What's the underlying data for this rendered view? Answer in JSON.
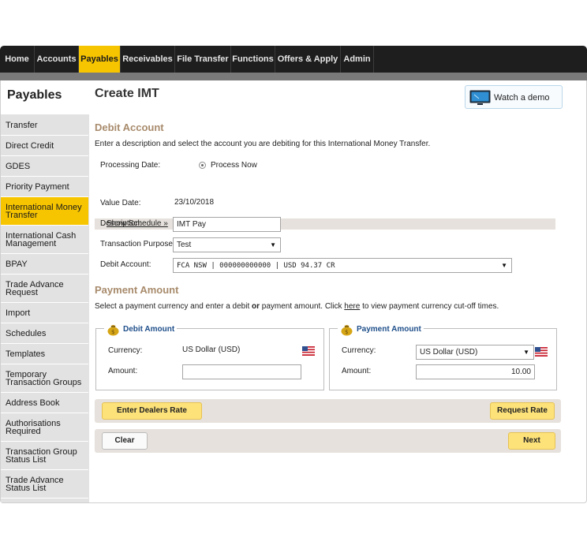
{
  "nav": {
    "tabs": [
      {
        "label": "Home"
      },
      {
        "label": "Accounts"
      },
      {
        "label": "Payables"
      },
      {
        "label": "Receivables"
      },
      {
        "label": "File Transfer"
      },
      {
        "label": "Functions"
      },
      {
        "label": "Offers & Apply"
      },
      {
        "label": "Admin"
      }
    ],
    "active_tab": "Payables"
  },
  "sidebar": {
    "title": "Payables",
    "items": [
      {
        "label": "Transfer"
      },
      {
        "label": "Direct Credit"
      },
      {
        "label": "GDES"
      },
      {
        "label": "Priority Payment"
      },
      {
        "label": "International Money Transfer"
      },
      {
        "label": "International Cash Management"
      },
      {
        "label": "BPAY"
      },
      {
        "label": "Trade Advance Request"
      },
      {
        "label": "Import"
      },
      {
        "label": "Schedules"
      },
      {
        "label": "Templates"
      },
      {
        "label": "Temporary Transaction Groups"
      },
      {
        "label": "Address Book"
      },
      {
        "label": "Authorisations Required"
      },
      {
        "label": "Transaction Group Status List"
      },
      {
        "label": "Trade Advance Status List"
      }
    ],
    "active_item": "International Money Transfer"
  },
  "main": {
    "title": "Create IMT",
    "demo_button": {
      "label": "Watch a demo",
      "icon": "monitor-icon"
    },
    "debit_account": {
      "heading": "Debit Account",
      "intro": "Enter a description and select the account you are debiting for this International Money Transfer.",
      "processing_date_label": "Processing Date:",
      "processing_date_option": "Process Now",
      "show_schedule": "Show Schedule »",
      "value_date_label": "Value Date:",
      "value_date": "23/10/2018",
      "description_label": "Description:",
      "description_value": "IMT Pay",
      "purpose_label": "Transaction Purpose:",
      "purpose_value": "Test",
      "account_label": "Debit Account:",
      "account_value": "FCA NSW | 000000000000 | USD 94.37 CR"
    },
    "payment_amount": {
      "heading": "Payment Amount",
      "intro_before": "Select a payment currency and enter a debit ",
      "intro_or": "or",
      "intro_middle": " payment amount. Click ",
      "intro_link": "here",
      "intro_after": " to view payment currency cut-off times.",
      "debit_box": {
        "title": "Debit Amount",
        "currency_label": "Currency:",
        "currency_value": "US Dollar (USD)",
        "amount_label": "Amount:",
        "amount_value": ""
      },
      "payment_box": {
        "title": "Payment Amount",
        "currency_label": "Currency:",
        "currency_value": "US Dollar (USD)",
        "amount_label": "Amount:",
        "amount_value": "10.00"
      }
    },
    "buttons": {
      "dealers_rate": "Enter Dealers Rate",
      "request_rate": "Request Rate",
      "clear": "Clear",
      "next": "Next"
    }
  },
  "colors": {
    "accent": "#f7c500",
    "nav_bg": "#1e1e1e",
    "section_heading": "#a88b6c",
    "legend_text": "#1f4f8a"
  }
}
